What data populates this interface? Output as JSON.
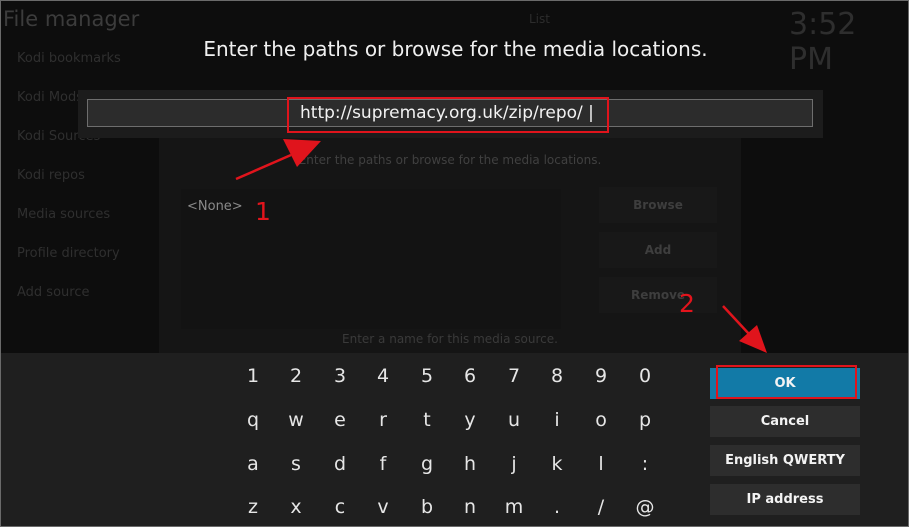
{
  "background": {
    "title": "File manager",
    "clock": "3:52 PM",
    "top_text": "List",
    "sidebar_items": [
      "Kodi bookmarks",
      "Kodi Mods",
      "Kodi Sources",
      "Kodi repos",
      "Media sources",
      "Profile directory",
      "Add source"
    ],
    "dialog": {
      "hint": "Enter the paths or browse for the media locations.",
      "none_label": "<None>",
      "browse_label": "Browse",
      "add_label": "Add",
      "remove_label": "Remove",
      "name_hint": "Enter a name for this media source."
    }
  },
  "keyboard_dialog": {
    "prompt": "Enter the paths or browse for the media locations.",
    "input_value": "http://supremacy.org.uk/zip/repo/ |",
    "rows": [
      [
        "1",
        "2",
        "3",
        "4",
        "5",
        "6",
        "7",
        "8",
        "9",
        "0"
      ],
      [
        "q",
        "w",
        "e",
        "r",
        "t",
        "y",
        "u",
        "i",
        "o",
        "p"
      ],
      [
        "a",
        "s",
        "d",
        "f",
        "g",
        "h",
        "j",
        "k",
        "l",
        ":"
      ],
      [
        "z",
        "x",
        "c",
        "v",
        "b",
        "n",
        "m",
        ".",
        "/",
        "@"
      ]
    ],
    "buttons": {
      "ok": "OK",
      "cancel": "Cancel",
      "layout": "English QWERTY",
      "ip": "IP address"
    }
  },
  "annotations": {
    "step1": "1",
    "step2": "2"
  },
  "colors": {
    "accent": "#127aa7",
    "highlight": "#e0141c",
    "panel": "#1f1f1f"
  }
}
